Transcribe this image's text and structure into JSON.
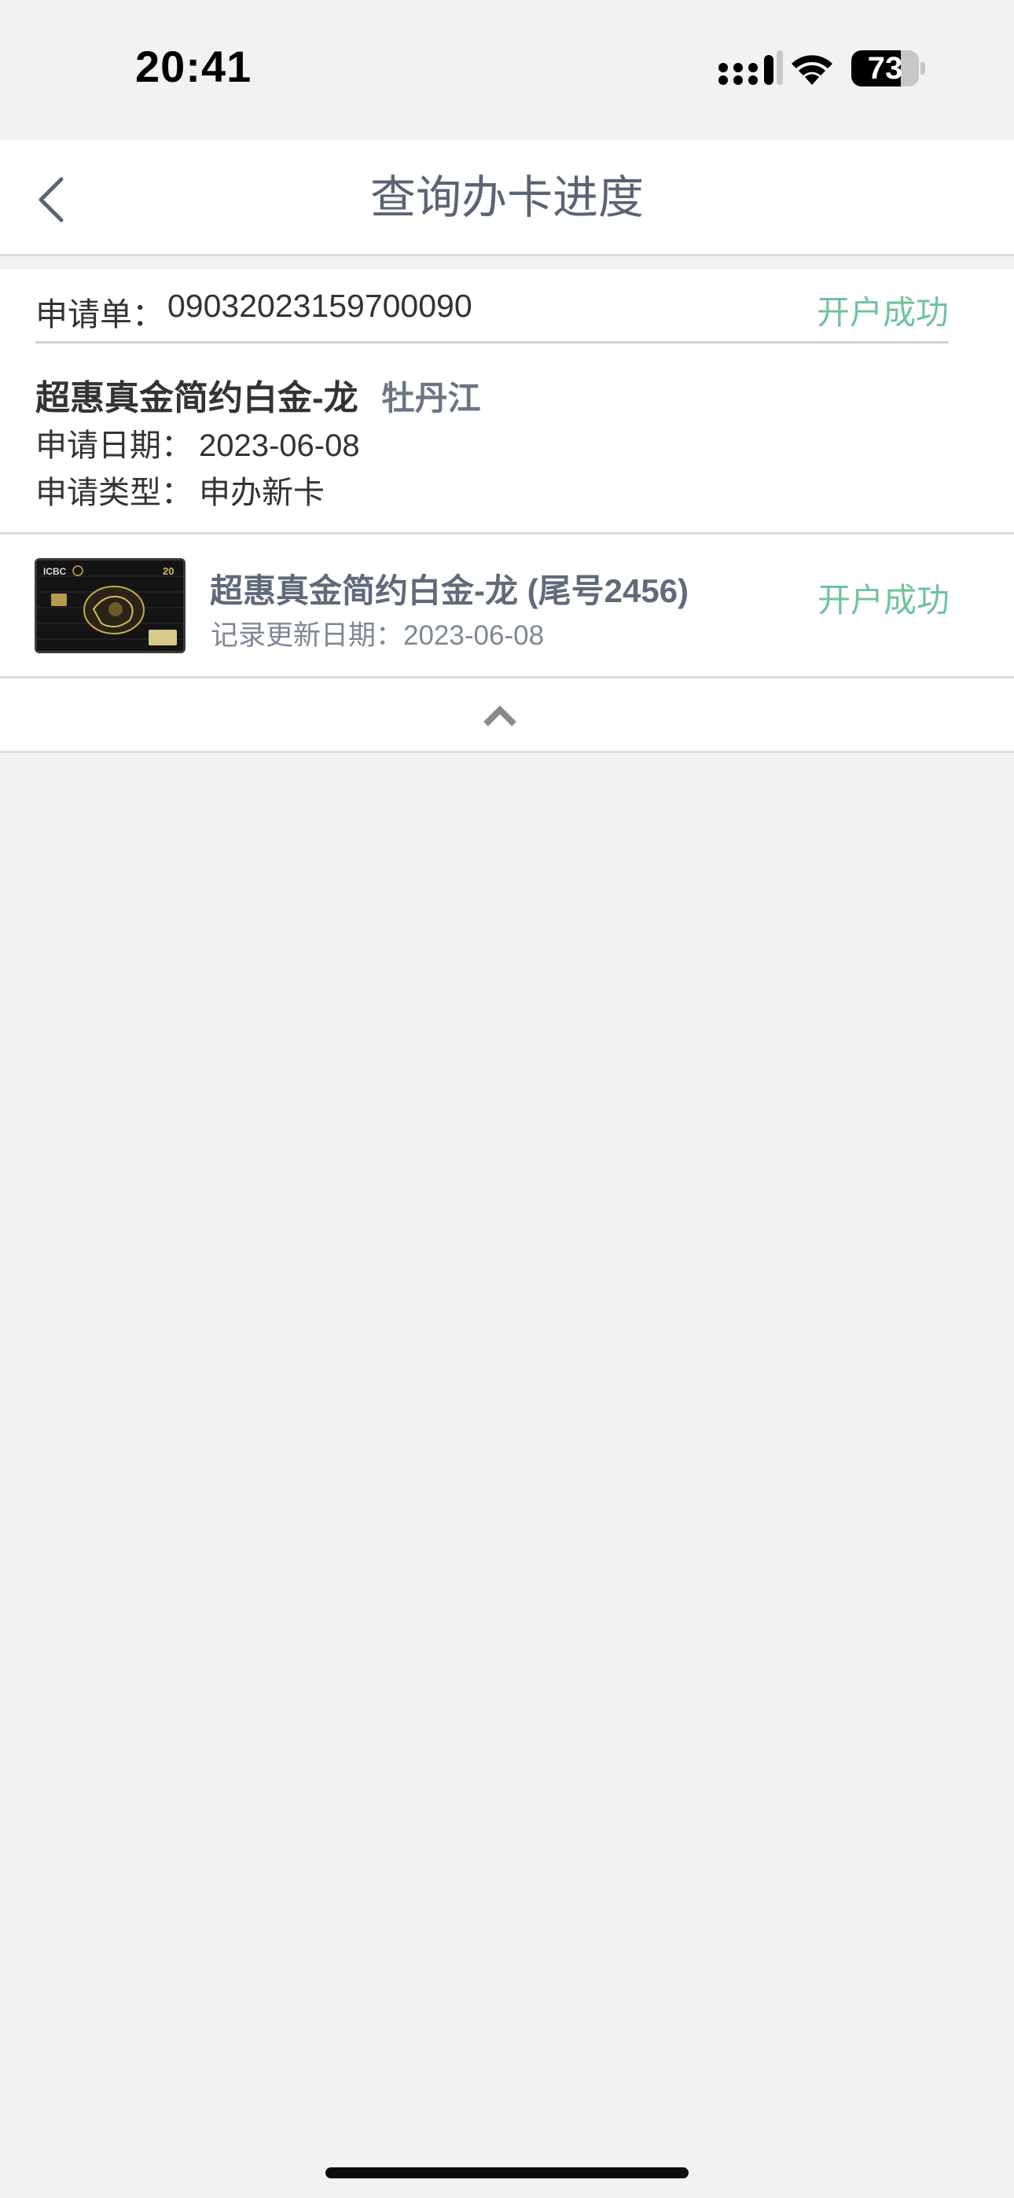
{
  "status_bar": {
    "time": "20:41",
    "battery_level": "73",
    "battery_fraction": 0.73,
    "icons": [
      "signal-icon",
      "wifi-icon",
      "battery-icon"
    ]
  },
  "nav": {
    "title": "查询办卡进度",
    "back_icon": "chevron-left-icon"
  },
  "application": {
    "number_label": "申请单：",
    "number": "09032023159700090",
    "status": "开户成功",
    "card_name": "超惠真金简约白金-龙",
    "city": "牡丹江",
    "date_label": "申请日期：",
    "date": "2023-06-08",
    "type_label": "申请类型：",
    "type": "申办新卡"
  },
  "card": {
    "title": "超惠真金简约白金-龙 (尾号2456)",
    "update": "记录更新日期：2023-06-08",
    "status": "开户成功",
    "thumbnail_icon": "credit-card-image",
    "brand_text": "ICBC"
  },
  "collapse": {
    "icon": "chevron-up-icon"
  },
  "colors": {
    "success": "#6fc49b",
    "title": "#5b6474",
    "background": "#f2f2f2"
  }
}
